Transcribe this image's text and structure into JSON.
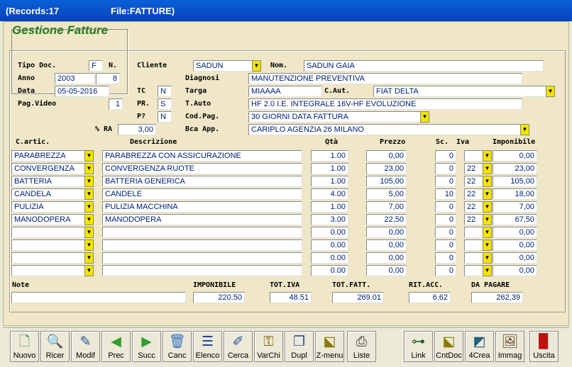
{
  "window": {
    "records": "(Records:17",
    "file": "File:FATTURE)"
  },
  "heading": "Gestione Fatture",
  "labels": {
    "tipo_doc": "Tipo Doc.",
    "n": "N.",
    "anno": "Anno",
    "data": "Data",
    "pag_video": "Pag.Video",
    "cliente": "Cliente",
    "nom": "Nom.",
    "diagnosi": "Diagnosi",
    "tc": "TC",
    "targa": "Targa",
    "c_aut": "C.Aut.",
    "pr": "PR.",
    "t_auto": "T.Auto",
    "p": "P?",
    "cod_pag": "Cod.Pag.",
    "ra": "% RA",
    "bca_app": "Bca App.",
    "c_artic": "C.artic.",
    "descrizione": "Descrizione",
    "qta": "Qtà",
    "prezzo": "Prezzo",
    "sc": "Sc.",
    "iva": "Iva",
    "imponibile": "Imponibile",
    "note": "Note",
    "tot_imponibile": "IMPONIBILE",
    "tot_iva": "TOT.IVA",
    "tot_fatt": "TOT.FATT.",
    "rit_acc": "RIT.ACC.",
    "da_pagare": "DA PAGARE"
  },
  "fields": {
    "tipo_doc": "F",
    "numero": "8",
    "anno": "2003",
    "data": "05-05-2016",
    "pag_video": "1",
    "cliente": "SADUN",
    "nominativo": "SADUN GAIA",
    "diagnosi": "MANUTENZIONE PREVENTIVA",
    "tc": "N",
    "targa": "MIAAAA",
    "c_aut": "FIAT DELTA",
    "pr": "S",
    "t_auto": "HF 2.0 I.E. INTEGRALE 16V-HF EVOLUZIONE",
    "p": "N",
    "cod_pag": "30 GIORNI DATA FATTURA",
    "ra": "3,00",
    "bca_app": "CARIPLO    AGENZIA 26   MILANO",
    "note": ""
  },
  "rows": [
    {
      "cod": "PARABREZZA",
      "desc": "PARABREZZA CON ASSICURAZIONE",
      "qta": "1.00",
      "prezzo": "0,00",
      "sc": "0",
      "iva": "",
      "imp": "0,00"
    },
    {
      "cod": "CONVERGENZA",
      "desc": "CONVERGENZA RUOTE",
      "qta": "1.00",
      "prezzo": "23,00",
      "sc": "0",
      "iva": "22",
      "imp": "23,00"
    },
    {
      "cod": "BATTERIA",
      "desc": "BATTERIA GENERICA",
      "qta": "1.00",
      "prezzo": "105,00",
      "sc": "0",
      "iva": "22",
      "imp": "105,00"
    },
    {
      "cod": "CANDELA",
      "desc": "CANDELE",
      "qta": "4.00",
      "prezzo": "5,00",
      "sc": "10",
      "iva": "22",
      "imp": "18,00"
    },
    {
      "cod": "PULIZIA",
      "desc": "PULIZIA MACCHINA",
      "qta": "1.00",
      "prezzo": "7,00",
      "sc": "0",
      "iva": "22",
      "imp": "7,00"
    },
    {
      "cod": "MANODOPERA",
      "desc": "MANODOPERA",
      "qta": "3.00",
      "prezzo": "22,50",
      "sc": "0",
      "iva": "22",
      "imp": "67,50"
    },
    {
      "cod": "",
      "desc": "",
      "qta": "0.00",
      "prezzo": "0,00",
      "sc": "0",
      "iva": "",
      "imp": "0,00"
    },
    {
      "cod": "",
      "desc": "",
      "qta": "0.00",
      "prezzo": "0,00",
      "sc": "0",
      "iva": "",
      "imp": "0,00"
    },
    {
      "cod": "",
      "desc": "",
      "qta": "0.00",
      "prezzo": "0,00",
      "sc": "0",
      "iva": "",
      "imp": "0,00"
    },
    {
      "cod": "",
      "desc": "",
      "qta": "0.00",
      "prezzo": "0,00",
      "sc": "0",
      "iva": "",
      "imp": "0,00"
    }
  ],
  "totals": {
    "imponibile": "220.50",
    "tot_iva": "48.51",
    "tot_fatt": "269.01",
    "rit_acc": "6.62",
    "da_pagare": "262,39"
  },
  "toolbar": [
    {
      "label": "Nuovo",
      "icon": "new-document-icon",
      "glyph": "🗋",
      "color": "#3a8a3a"
    },
    {
      "label": "Ricer",
      "icon": "search-icon",
      "glyph": "🔍",
      "color": "#2050a0"
    },
    {
      "label": "Modif",
      "icon": "edit-icon",
      "glyph": "✎",
      "color": "#2050a0"
    },
    {
      "label": "Prec",
      "icon": "arrow-left-icon",
      "glyph": "◀",
      "color": "#2ea02e"
    },
    {
      "label": "Succ",
      "icon": "arrow-right-icon",
      "glyph": "▶",
      "color": "#2ea02e"
    },
    {
      "label": "Canc",
      "icon": "trash-icon",
      "glyph": "🗑",
      "color": "#3070c0"
    },
    {
      "label": "Elenco",
      "icon": "list-icon",
      "glyph": "☰",
      "color": "#1a3a8a"
    },
    {
      "label": "Cerca",
      "icon": "find-icon",
      "glyph": "✐",
      "color": "#2050a0"
    },
    {
      "label": "VarChi",
      "icon": "keys-icon",
      "glyph": "⚿",
      "color": "#806000"
    },
    {
      "label": "Dupl",
      "icon": "duplicate-icon",
      "glyph": "❐",
      "color": "#2050a0"
    },
    {
      "label": "Z-menu",
      "icon": "menu-chart-icon",
      "glyph": "⬕",
      "color": "#8a7a00"
    },
    {
      "label": "Liste",
      "icon": "printer-icon",
      "glyph": "⎙",
      "color": "#404040"
    },
    {
      "label": "Link",
      "icon": "link-tree-icon",
      "glyph": "⊶",
      "color": "#206020"
    },
    {
      "label": "CntDoc",
      "icon": "count-chart-icon",
      "glyph": "⬕",
      "color": "#8a7a00"
    },
    {
      "label": "4Crea",
      "icon": "create-chart-icon",
      "glyph": "◩",
      "color": "#206080"
    },
    {
      "label": "Immag",
      "icon": "image-card-icon",
      "glyph": "🖼",
      "color": "#604020"
    },
    {
      "label": "Uscita",
      "icon": "exit-door-icon",
      "glyph": "▉",
      "color": "#c01010"
    }
  ]
}
